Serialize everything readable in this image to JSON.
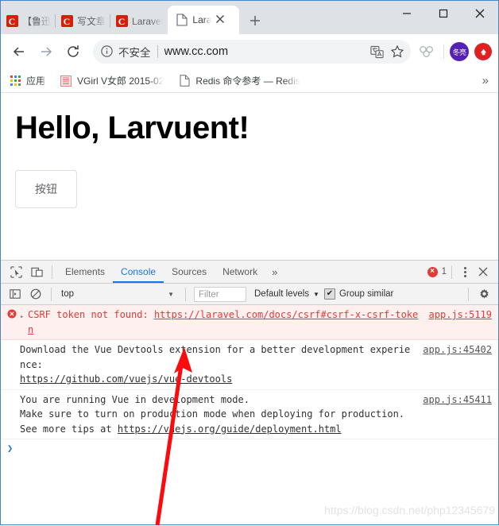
{
  "window": {
    "controls": {
      "minimize": "—",
      "maximize": "□",
      "close": "✕"
    }
  },
  "tabstrip": {
    "tabs": [
      {
        "title": "【鲁迅",
        "icon": "csdn-icon",
        "active": false
      },
      {
        "title": "写文章",
        "icon": "csdn-icon",
        "active": false
      },
      {
        "title": "Laravel",
        "icon": "csdn-icon",
        "active": false
      },
      {
        "title": "Laravel",
        "icon": "document-icon",
        "active": true
      }
    ],
    "new_tab_label": "+",
    "close_tab_label": "✕"
  },
  "toolbar": {
    "back_label": "←",
    "forward_label": "→",
    "reload_label": "↻",
    "security_text": "不安全",
    "url": "www.cc.com",
    "translate_icon": "translate-icon",
    "bookmark_icon": "star-icon",
    "extension_icon": "extension-icon",
    "avatar_label": "冬亮",
    "profile_color": "#5521b5",
    "action_color": "#e02020"
  },
  "bookmarks": {
    "items": [
      {
        "label": "应用",
        "icon": "apps-grid-icon"
      },
      {
        "label": "VGirl V女郎 2015-02",
        "icon": "vgirl-favicon"
      },
      {
        "label": "Redis 命令参考 — Redis",
        "icon": "document-icon"
      }
    ],
    "overflow_label": "»"
  },
  "page": {
    "heading": "Hello, Larvuent!",
    "button_label": "按钮"
  },
  "devtools": {
    "inspect_icon": "inspect-element-icon",
    "device_icon": "device-toolbar-icon",
    "tabs": [
      {
        "label": "Elements",
        "active": false
      },
      {
        "label": "Console",
        "active": true
      },
      {
        "label": "Sources",
        "active": false
      },
      {
        "label": "Network",
        "active": false
      }
    ],
    "more_tabs_label": "»",
    "error_count": "1",
    "menu_icon": "kebab-menu-icon",
    "close_label": "✕",
    "console_toolbar": {
      "sidebar_toggle_icon": "console-sidebar-icon",
      "clear_icon": "clear-console-icon",
      "context": "top",
      "context_caret": "▼",
      "filter_placeholder": "Filter",
      "levels": "Default levels",
      "levels_caret": "▼",
      "group_similar_label": "Group similar",
      "group_similar_checked": true,
      "check_glyph": "✔",
      "settings_icon": "settings-gear-icon"
    },
    "messages": [
      {
        "type": "error",
        "expand_glyph": "▸",
        "text_pre": "CSRF token not found: ",
        "link": "https://laravel.com/docs/csrf#csrf-x-csrf-token",
        "source": "app.js:5119"
      },
      {
        "type": "log",
        "text_pre": "Download the Vue Devtools extension for a better development experience:",
        "link": "https://github.com/vuejs/vue-devtools",
        "source": "app.js:45402"
      },
      {
        "type": "log",
        "text_pre": "You are running Vue in development mode.\nMake sure to turn on production mode when deploying for production.\nSee more tips at ",
        "link": "https://vuejs.org/guide/deployment.html",
        "source": "app.js:45411"
      }
    ],
    "prompt_glyph": "❯"
  },
  "annotation": {
    "arrow_color": "#fb0b0b"
  },
  "watermark": {
    "text": "https://blog.csdn.net/php12345679"
  }
}
